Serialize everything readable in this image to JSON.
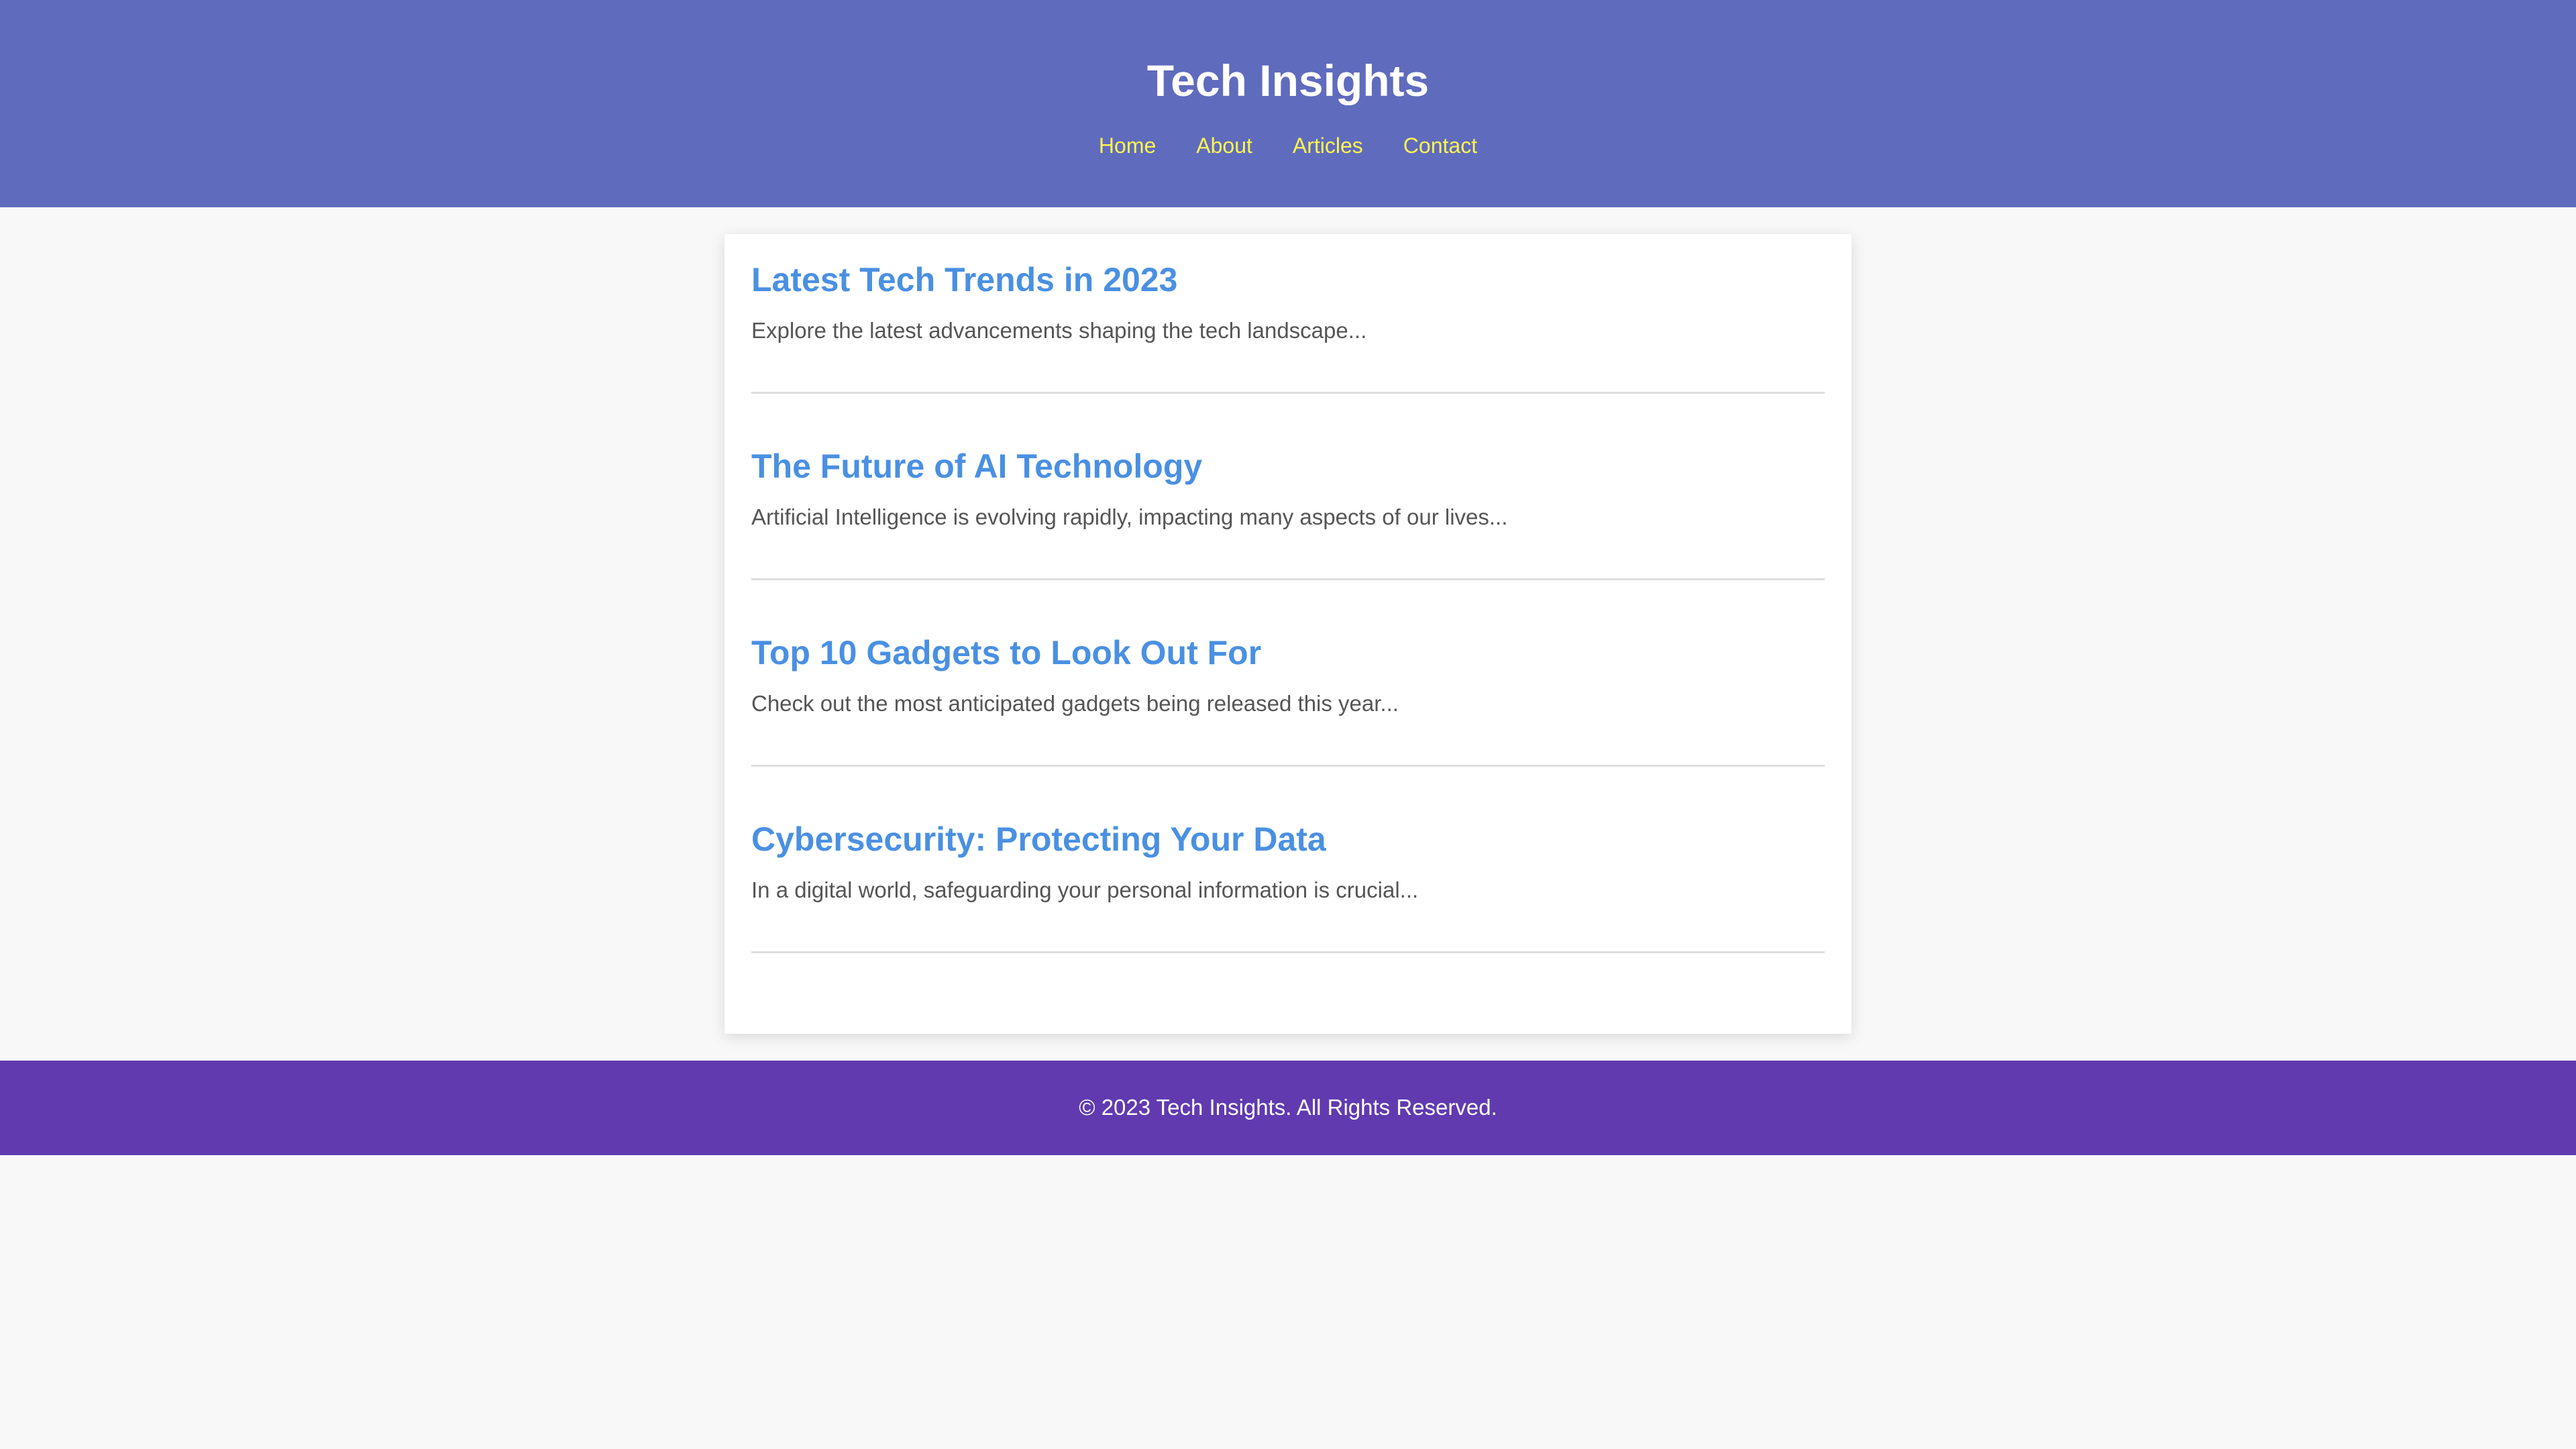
{
  "header": {
    "title": "Tech Insights",
    "nav": [
      "Home",
      "About",
      "Articles",
      "Contact"
    ]
  },
  "articles": [
    {
      "title": "Latest Tech Trends in 2023",
      "summary": "Explore the latest advancements shaping the tech landscape..."
    },
    {
      "title": "The Future of AI Technology",
      "summary": "Artificial Intelligence is evolving rapidly, impacting many aspects of our lives..."
    },
    {
      "title": "Top 10 Gadgets to Look Out For",
      "summary": "Check out the most anticipated gadgets being released this year..."
    },
    {
      "title": "Cybersecurity: Protecting Your Data",
      "summary": "In a digital world, safeguarding your personal information is crucial..."
    }
  ],
  "footer": {
    "text": "© 2023 Tech Insights. All Rights Reserved."
  },
  "colors": {
    "header_background": "#5f6bbd",
    "nav_link": "#fff44f",
    "article_title": "#4a90e2",
    "footer_background": "#613ab0",
    "page_background": "#f8f8f8"
  }
}
